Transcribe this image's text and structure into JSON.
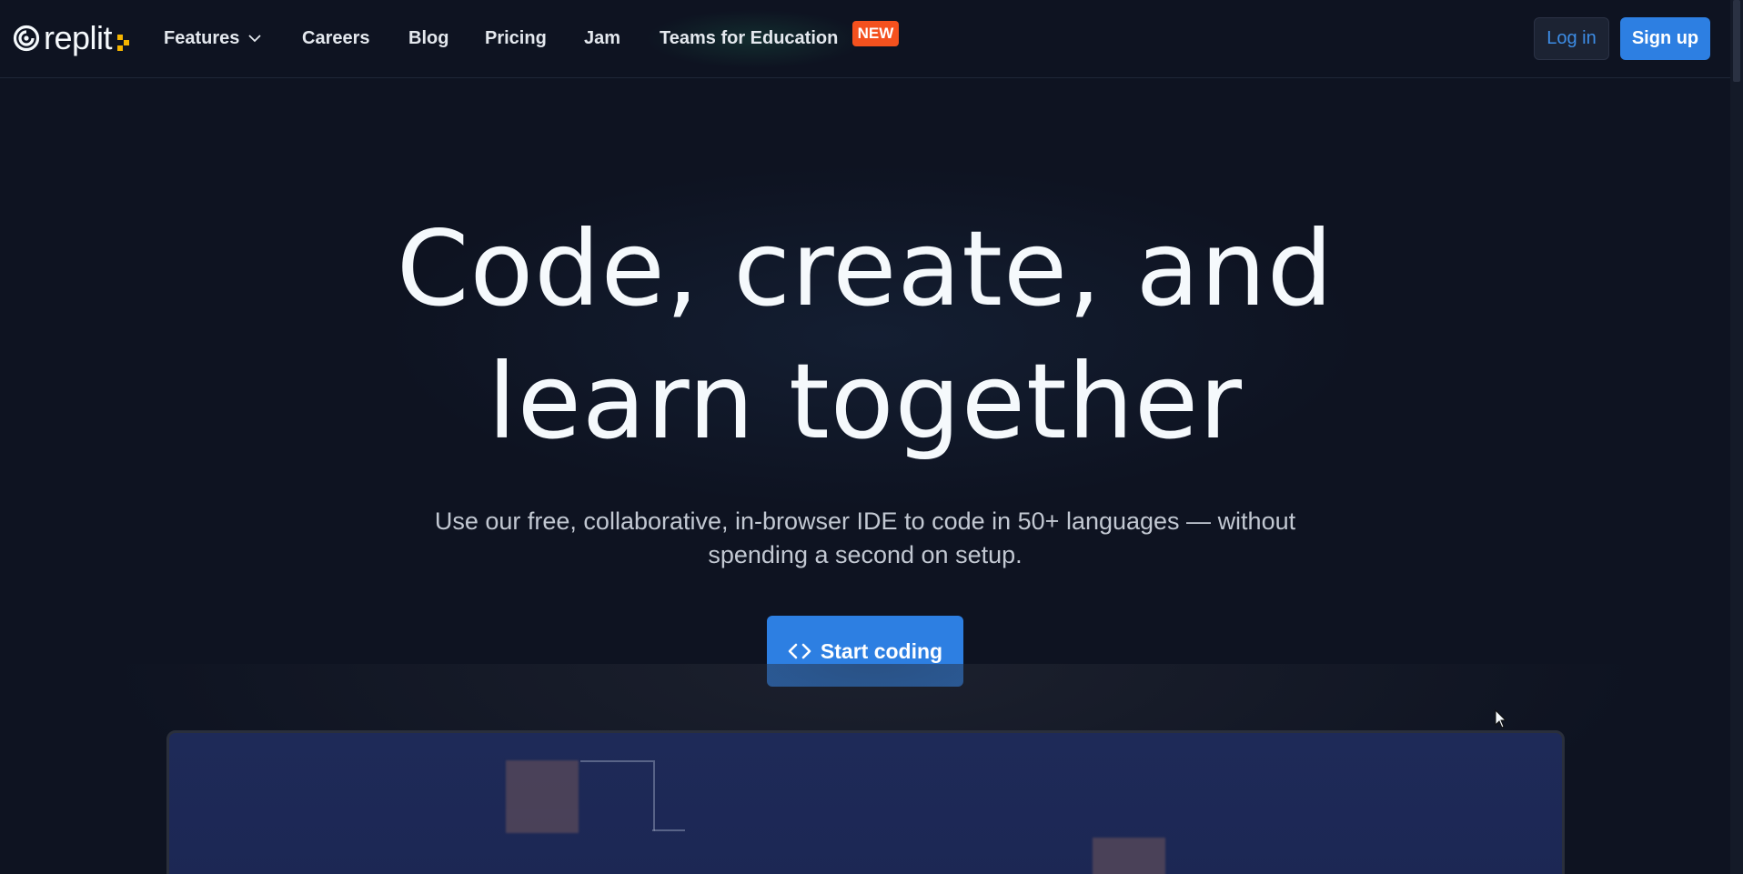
{
  "brand": {
    "name": "replit"
  },
  "nav": {
    "features": "Features",
    "careers": "Careers",
    "blog": "Blog",
    "pricing": "Pricing",
    "jam": "Jam",
    "teams": "Teams for Education",
    "new_badge": "NEW"
  },
  "auth": {
    "login": "Log in",
    "signup": "Sign up"
  },
  "hero": {
    "title_line1": "Code, create, and",
    "title_line2": "learn together",
    "subtitle_line1": "Use our free, collaborative, in-browser IDE to code in 50+ languages — without",
    "subtitle_line2": "spending a second on setup.",
    "cta": "Start coding"
  },
  "colors": {
    "background": "#0e1321",
    "accent_blue": "#2d7fe2",
    "login_text": "#3d8de6",
    "badge_orange": "#f4511e",
    "logo_dots": "#f5b400"
  },
  "icons": {
    "logo": "replit-logo-icon",
    "features_chevron": "chevron-down-icon",
    "cta": "code-brackets-icon",
    "cursor": "mouse-pointer-icon"
  }
}
